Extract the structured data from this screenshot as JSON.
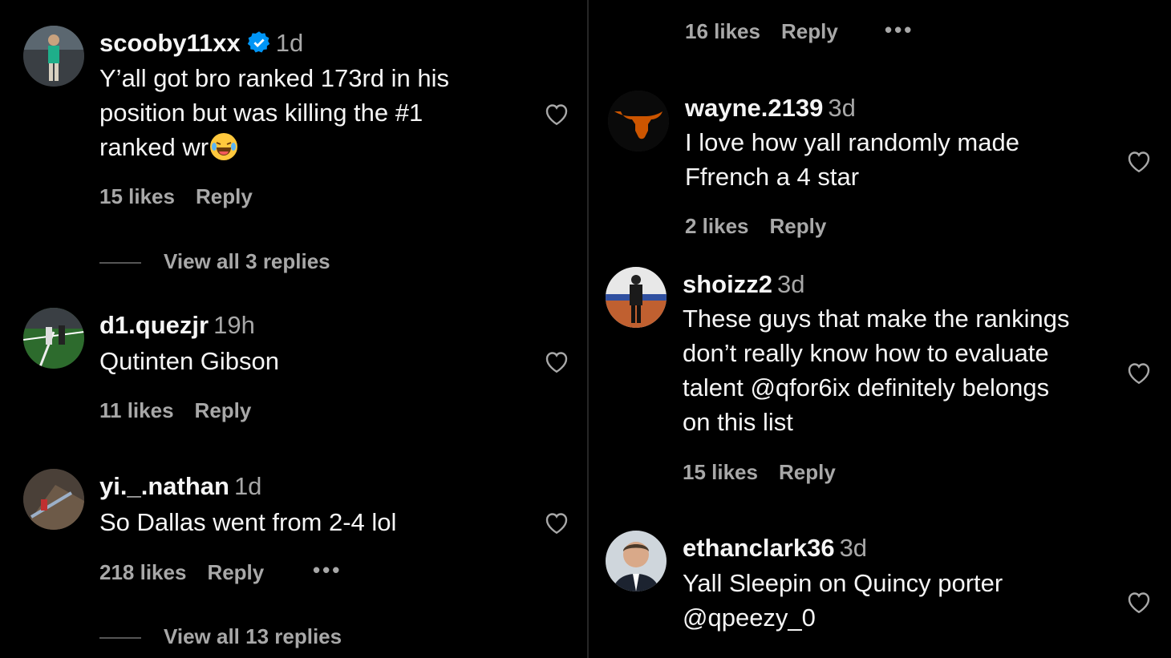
{
  "left": [
    {
      "user": "scooby11xx",
      "time": "1d",
      "verified": true,
      "lines": [
        "Y’all got bro ranked 173rd in his",
        "position but was killing the #1",
        "ranked wr"
      ],
      "likes": "15 likes",
      "reply": "Reply",
      "view_replies": "View all 3 replies"
    },
    {
      "user": "d1.quezjr",
      "time": "19h",
      "lines": [
        "Qutinten Gibson"
      ],
      "likes": "11 likes",
      "reply": "Reply"
    },
    {
      "user": "yi._.nathan",
      "time": "1d",
      "lines": [
        "So Dallas went from 2-4 lol"
      ],
      "likes": "218 likes",
      "reply": "Reply",
      "more": "•••",
      "view_replies": "View all 13 replies"
    }
  ],
  "right": [
    {
      "likes": "16 likes",
      "reply": "Reply",
      "more": "•••"
    },
    {
      "user": "wayne.2139",
      "time": "3d",
      "lines": [
        "I love how yall randomly made",
        "Ffrench a 4 star"
      ],
      "likes": "2 likes",
      "reply": "Reply"
    },
    {
      "user": "shoizz2",
      "time": "3d",
      "lines": [
        "These guys that make the rankings",
        "don’t really know how to evaluate",
        "talent @qfor6ix definitely belongs",
        "on this list"
      ],
      "likes": "15 likes",
      "reply": "Reply"
    },
    {
      "user": "ethanclark36",
      "time": "3d",
      "lines": [
        "Yall Sleepin on Quincy porter",
        "@qpeezy_0"
      ]
    }
  ],
  "colors": {
    "background": "#000000",
    "text": "#f5f5f5",
    "muted": "#a8a8a8",
    "verified": "#0095f6",
    "longhorn": "#cc5500"
  },
  "icons": {
    "like": "heart-outline-icon",
    "verified": "verified-badge-icon",
    "more": "more-options-icon",
    "emoji": "laughing-crying-emoji"
  }
}
